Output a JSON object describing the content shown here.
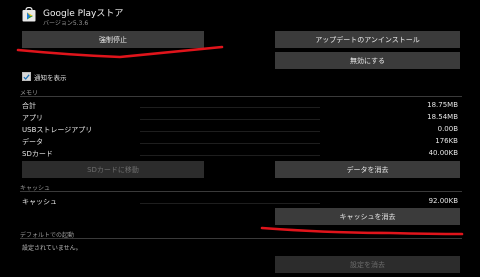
{
  "header": {
    "app_name": "Google Playストア",
    "version": "バージョン5.3.6"
  },
  "buttons": {
    "force_stop": "強制停止",
    "uninstall_updates": "アップデートのアンインストール",
    "disable": "無効にする",
    "move_to_sd": "SDカードに移動",
    "clear_data": "データを消去",
    "clear_cache": "キャッシュを消去",
    "clear_defaults": "設定を消去"
  },
  "notifications": {
    "checkbox_label": "通知を表示",
    "checked": true
  },
  "memory": {
    "section_title": "メモリ",
    "rows": [
      {
        "label": "合計",
        "value": "18.75MB"
      },
      {
        "label": "アプリ",
        "value": "18.54MB"
      },
      {
        "label": "USBストレージアプリ",
        "value": "0.00B"
      },
      {
        "label": "データ",
        "value": "176KB"
      },
      {
        "label": "SDカード",
        "value": "40.00KB"
      }
    ]
  },
  "cache": {
    "section_title": "キャッシュ",
    "label": "キャッシュ",
    "value": "92.00KB"
  },
  "defaults": {
    "section_title": "デフォルトでの起動",
    "description": "設定されていません。"
  },
  "colors": {
    "background": "#000000",
    "button": "#3b3b3b",
    "annotation": "#e0141b"
  },
  "icons": {
    "app": "play-store-icon",
    "check": "check-icon"
  }
}
